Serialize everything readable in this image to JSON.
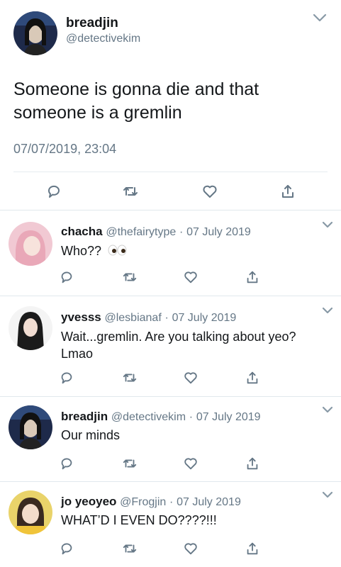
{
  "main_tweet": {
    "author_name": "breadjin",
    "author_handle": "@detectivekim",
    "text": "Someone is gonna die and that someone is a gremlin",
    "timestamp": "07/07/2019, 23:04",
    "avatar_colors": [
      "#1e2a4a",
      "#d9c9b8"
    ]
  },
  "replies": [
    {
      "name": "chacha",
      "handle": "@thefairytype",
      "separator": "·",
      "date": "07 July 2019",
      "text": "Who??",
      "emoji": "eyes",
      "avatar_colors": [
        "#f1c9d3",
        "#e9a8b8"
      ]
    },
    {
      "name": "yvesss",
      "handle": "@lesbianaf",
      "separator": "·",
      "date": "07 July 2019",
      "text": "Wait...gremlin. Are you talking about yeo? Lmao",
      "avatar_colors": [
        "#f4f4f4",
        "#1b1b1b"
      ]
    },
    {
      "name": "breadjin",
      "handle": "@detectivekim",
      "separator": "·",
      "date": "07 July 2019",
      "text": "Our minds",
      "avatar_colors": [
        "#1e2a4a",
        "#d9c9b8"
      ]
    },
    {
      "name": "jo yeoyeo",
      "handle": "@Frogjin",
      "separator": "·",
      "date": "07 July 2019",
      "text": "WHAT’D I EVEN DO????!!!",
      "avatar_colors": [
        "#e9d36a",
        "#3a2a20"
      ]
    }
  ],
  "icons": {
    "reply": "reply-icon",
    "retweet": "retweet-icon",
    "like": "heart-icon",
    "share": "share-icon",
    "menu": "chevron-down-icon"
  },
  "colors": {
    "text": "#14171a",
    "secondary": "#657786",
    "divider": "#e1e8ed"
  }
}
